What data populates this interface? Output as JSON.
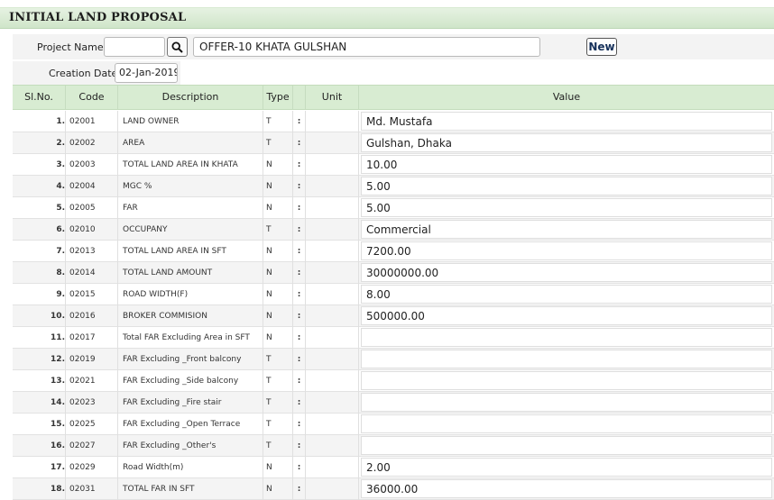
{
  "header": {
    "title": "INITIAL LAND PROPOSAL"
  },
  "form": {
    "project_label": "Project Name",
    "project_code": "",
    "project_name": "OFFER-10 KHATA GULSHAN",
    "new_label": "New",
    "creation_label": "Creation Date",
    "creation_date": "02-Jan-2019"
  },
  "columns": {
    "sl": "Sl.No.",
    "code": "Code",
    "description": "Description",
    "type": "Type",
    "unit": "Unit",
    "value": "Value"
  },
  "rows": [
    {
      "sl": "1.",
      "code": "02001",
      "description": "LAND OWNER",
      "type": "T",
      "colon": ":",
      "unit": "",
      "value": "Md. Mustafa"
    },
    {
      "sl": "2.",
      "code": "02002",
      "description": "AREA",
      "type": "T",
      "colon": ":",
      "unit": "",
      "value": "Gulshan, Dhaka"
    },
    {
      "sl": "3.",
      "code": "02003",
      "description": "TOTAL LAND AREA IN KHATA",
      "type": "N",
      "colon": ":",
      "unit": "",
      "value": "10.00"
    },
    {
      "sl": "4.",
      "code": "02004",
      "description": "MGC %",
      "type": "N",
      "colon": ":",
      "unit": "",
      "value": "5.00"
    },
    {
      "sl": "5.",
      "code": "02005",
      "description": "FAR",
      "type": "N",
      "colon": ":",
      "unit": "",
      "value": "5.00"
    },
    {
      "sl": "6.",
      "code": "02010",
      "description": "OCCUPANY",
      "type": "T",
      "colon": ":",
      "unit": "",
      "value": "Commercial"
    },
    {
      "sl": "7.",
      "code": "02013",
      "description": "TOTAL LAND AREA IN SFT",
      "type": "N",
      "colon": ":",
      "unit": "",
      "value": "7200.00"
    },
    {
      "sl": "8.",
      "code": "02014",
      "description": "TOTAL LAND AMOUNT",
      "type": "N",
      "colon": ":",
      "unit": "",
      "value": "30000000.00"
    },
    {
      "sl": "9.",
      "code": "02015",
      "description": "ROAD WIDTH(F)",
      "type": "N",
      "colon": ":",
      "unit": "",
      "value": "8.00"
    },
    {
      "sl": "10.",
      "code": "02016",
      "description": "BROKER COMMISION",
      "type": "N",
      "colon": ":",
      "unit": "",
      "value": "500000.00"
    },
    {
      "sl": "11.",
      "code": "02017",
      "description": "Total FAR Excluding Area in SFT",
      "type": "N",
      "colon": ":",
      "unit": "",
      "value": ""
    },
    {
      "sl": "12.",
      "code": "02019",
      "description": "FAR Excluding _Front balcony",
      "type": "T",
      "colon": ":",
      "unit": "",
      "value": ""
    },
    {
      "sl": "13.",
      "code": "02021",
      "description": "FAR Excluding _Side balcony",
      "type": "T",
      "colon": ":",
      "unit": "",
      "value": ""
    },
    {
      "sl": "14.",
      "code": "02023",
      "description": "FAR Excluding _Fire stair",
      "type": "T",
      "colon": ":",
      "unit": "",
      "value": ""
    },
    {
      "sl": "15.",
      "code": "02025",
      "description": "FAR Excluding _Open Terrace",
      "type": "T",
      "colon": ":",
      "unit": "",
      "value": ""
    },
    {
      "sl": "16.",
      "code": "02027",
      "description": "FAR Excluding _Other's",
      "type": "T",
      "colon": ":",
      "unit": "",
      "value": ""
    },
    {
      "sl": "17.",
      "code": "02029",
      "description": "Road Width(m)",
      "type": "N",
      "colon": ":",
      "unit": "",
      "value": "2.00"
    },
    {
      "sl": "18.",
      "code": "02031",
      "description": "TOTAL FAR IN SFT",
      "type": "N",
      "colon": ":",
      "unit": "",
      "value": "36000.00"
    }
  ]
}
